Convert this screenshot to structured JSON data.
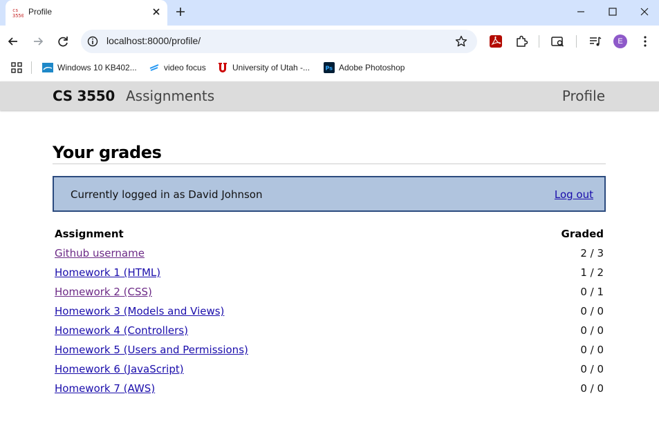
{
  "browser": {
    "tab_title": "Profile",
    "url": "localhost:8000/profile/",
    "avatar_letter": "E",
    "bookmarks": [
      {
        "label": "Windows 10 KB402...",
        "icon": "windows-update-icon"
      },
      {
        "label": "video focus",
        "icon": "video-focus-icon"
      },
      {
        "label": "University of Utah -...",
        "icon": "utah-u-icon"
      },
      {
        "label": "Adobe Photoshop",
        "icon": "photoshop-icon"
      }
    ]
  },
  "site": {
    "brand": "CS 3550",
    "nav_assignments": "Assignments",
    "nav_profile": "Profile"
  },
  "page": {
    "heading": "Your grades",
    "login_text": "Currently logged in as David Johnson",
    "logout_label": "Log out"
  },
  "table": {
    "headers": {
      "assignment": "Assignment",
      "graded": "Graded"
    },
    "rows": [
      {
        "title": "Github username",
        "graded": "2 / 3",
        "visited": true
      },
      {
        "title": "Homework 1 (HTML)",
        "graded": "1 / 2",
        "visited": false
      },
      {
        "title": "Homework 2 (CSS)",
        "graded": "0 / 1",
        "visited": true
      },
      {
        "title": "Homework 3 (Models and Views)",
        "graded": "0 / 0",
        "visited": false
      },
      {
        "title": "Homework 4 (Controllers)",
        "graded": "0 / 0",
        "visited": false
      },
      {
        "title": "Homework 5 (Users and Permissions)",
        "graded": "0 / 0",
        "visited": false
      },
      {
        "title": "Homework 6 (JavaScript)",
        "graded": "0 / 0",
        "visited": false
      },
      {
        "title": "Homework 7 (AWS)",
        "graded": "0 / 0",
        "visited": false
      }
    ]
  },
  "colors": {
    "tabstrip": "#d3e3fd",
    "nav_bg": "#dcdcdc",
    "login_bg": "#b0c4de",
    "login_border": "#2b4a7e",
    "link": "#1a0dab",
    "link_visited": "#6c2a86"
  }
}
